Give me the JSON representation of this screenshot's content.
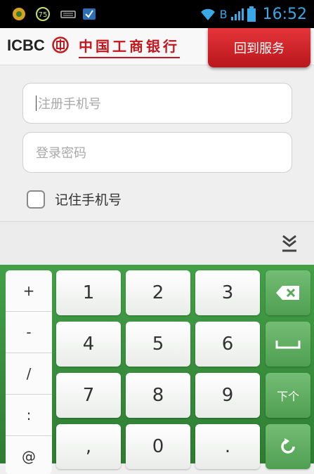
{
  "status_bar": {
    "time": "16:52",
    "network_label": "B",
    "battery_badge": "75",
    "icons": [
      "app-icon",
      "battery-circle-icon",
      "keyboard-icon",
      "download-icon",
      "wifi-icon",
      "signal-icon",
      "battery-icon"
    ]
  },
  "header": {
    "brand": "ICBC",
    "bank_name": "中国工商银行",
    "service_button": "回到服务"
  },
  "form": {
    "phone_placeholder": "注册手机号",
    "password_placeholder": "登录密码",
    "remember_label": "记住手机号",
    "remember_checked": false
  },
  "keyboard": {
    "symbols": [
      "+",
      "-",
      "/",
      ":",
      "@"
    ],
    "digits": [
      "1",
      "2",
      "3",
      "4",
      "5",
      "6",
      "7",
      "8",
      "9",
      ",",
      "0",
      "."
    ],
    "next_label": "下个",
    "colors": {
      "accent": "#43a047",
      "function_key": "#5aaa5c",
      "brand_red": "#c4161c"
    }
  }
}
